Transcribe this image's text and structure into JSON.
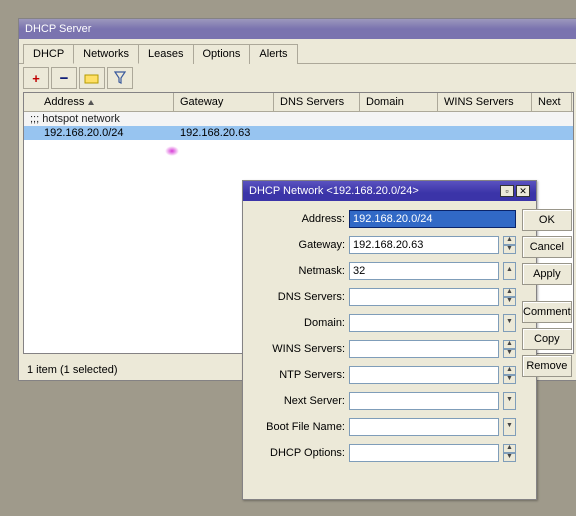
{
  "mainWindow": {
    "title": "DHCP Server",
    "tabs": [
      "DHCP",
      "Networks",
      "Leases",
      "Options",
      "Alerts"
    ],
    "activeTab": 1,
    "columns": {
      "address": "Address",
      "gateway": "Gateway",
      "dns": "DNS Servers",
      "domain": "Domain",
      "wins": "WINS Servers",
      "next": "Next"
    },
    "commentRow": ";;; hotspot network",
    "row": {
      "address": "192.168.20.0/24",
      "gateway": "192.168.20.63"
    },
    "status": "1 item (1 selected)"
  },
  "dialog": {
    "title": "DHCP Network <192.168.20.0/24>",
    "fields": {
      "address": {
        "label": "Address:",
        "value": "192.168.20.0/24"
      },
      "gateway": {
        "label": "Gateway:",
        "value": "192.168.20.63"
      },
      "netmask": {
        "label": "Netmask:",
        "value": "32"
      },
      "dns": {
        "label": "DNS Servers:",
        "value": ""
      },
      "domain": {
        "label": "Domain:",
        "value": ""
      },
      "wins": {
        "label": "WINS Servers:",
        "value": ""
      },
      "ntp": {
        "label": "NTP Servers:",
        "value": ""
      },
      "next": {
        "label": "Next Server:",
        "value": ""
      },
      "boot": {
        "label": "Boot File Name:",
        "value": ""
      },
      "opts": {
        "label": "DHCP Options:",
        "value": ""
      }
    },
    "buttons": {
      "ok": "OK",
      "cancel": "Cancel",
      "apply": "Apply",
      "comment": "Comment",
      "copy": "Copy",
      "remove": "Remove"
    }
  }
}
